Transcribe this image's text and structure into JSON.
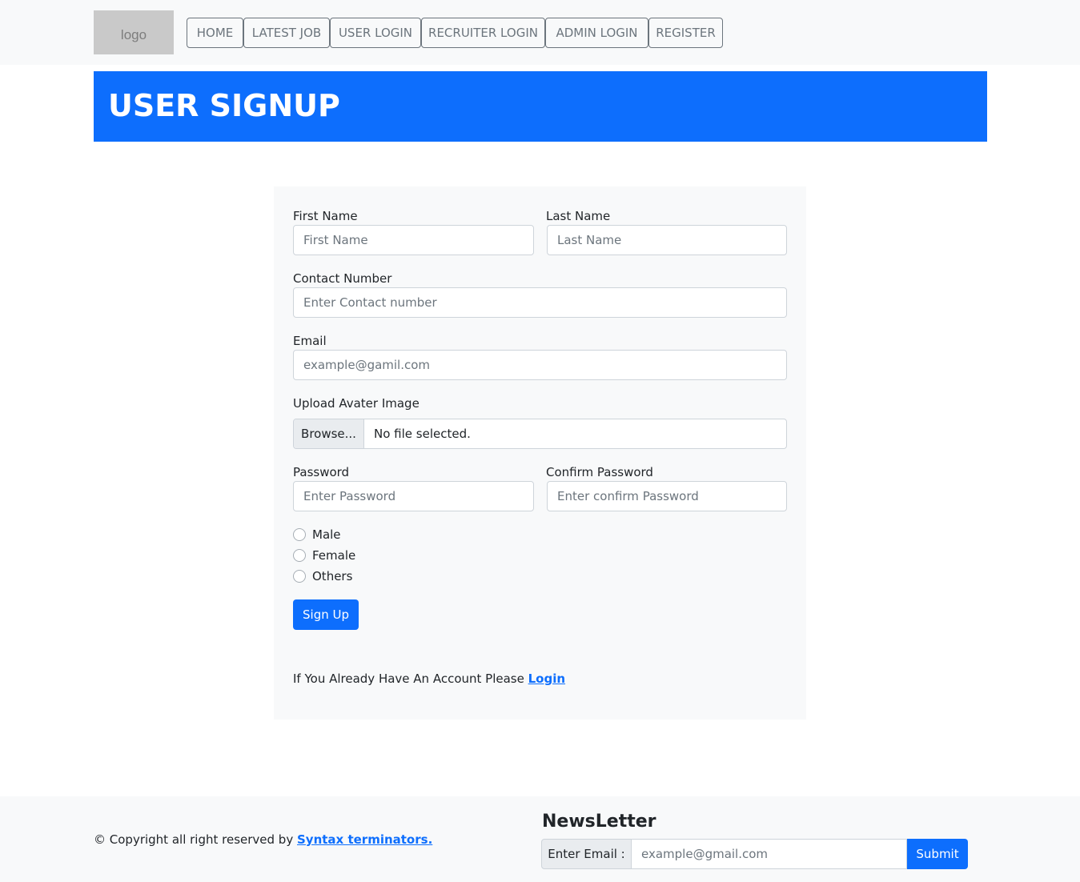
{
  "navbar": {
    "logo_text": "logo",
    "items": [
      {
        "label": "HOME"
      },
      {
        "label": "LATEST JOB"
      },
      {
        "label": "USER LOGIN"
      },
      {
        "label": "RECRUITER LOGIN"
      },
      {
        "label": "ADMIN LOGIN"
      },
      {
        "label": "REGISTER"
      }
    ]
  },
  "banner": {
    "title": "USER SIGNUP"
  },
  "form": {
    "first_name": {
      "label": "First Name",
      "placeholder": "First Name"
    },
    "last_name": {
      "label": "Last Name",
      "placeholder": "Last Name"
    },
    "contact": {
      "label": "Contact Number",
      "placeholder": "Enter Contact number"
    },
    "email": {
      "label": "Email",
      "placeholder": "example@gamil.com"
    },
    "avatar": {
      "label": "Upload Avater Image",
      "button": "Browse...",
      "status": "No file selected."
    },
    "password": {
      "label": "Password",
      "placeholder": "Enter Password"
    },
    "confirm_password": {
      "label": "Confirm Password",
      "placeholder": "Enter confirm Password"
    },
    "gender_options": [
      {
        "label": "Male"
      },
      {
        "label": "Female"
      },
      {
        "label": "Others"
      }
    ],
    "submit_label": "Sign Up",
    "account_prompt": "If You Already Have An Account Please",
    "login_link": "Login"
  },
  "footer": {
    "copyright_text": "© Copyright all right reserved by",
    "copyright_link": "Syntax terminators.",
    "newsletter": {
      "title": "NewsLetter",
      "label": "Enter Email :",
      "placeholder": "example@gmail.com",
      "submit_label": "Submit"
    }
  },
  "colors": {
    "primary": "#0d6efd",
    "light_bg": "#f8f9fa",
    "nav_border": "#6c757d"
  }
}
